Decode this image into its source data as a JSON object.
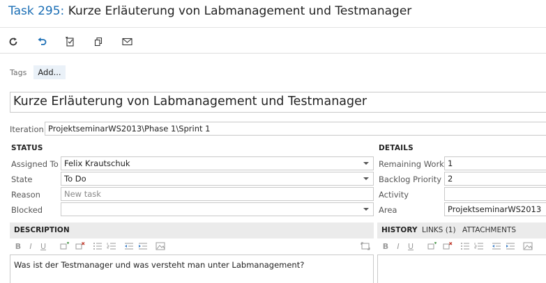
{
  "window": {
    "task_id": "Task 295:",
    "task_title": "Kurze Erläuterung von Labmanagement und Testmanager"
  },
  "toolbar": {
    "items": [
      "refresh-icon",
      "undo-icon",
      "checklist-icon",
      "copy-icon",
      "email-icon"
    ]
  },
  "tags": {
    "label": "Tags",
    "add_label": "Add..."
  },
  "title_field": {
    "value": "Kurze Erläuterung von Labmanagement und Testmanager"
  },
  "iteration": {
    "label": "Iteration",
    "value": "ProjektseminarWS2013\\Phase 1\\Sprint 1"
  },
  "status": {
    "header": "STATUS",
    "assigned_to": {
      "label": "Assigned To",
      "value": "Felix Krautschuk"
    },
    "state": {
      "label": "State",
      "value": "To Do"
    },
    "reason": {
      "label": "Reason",
      "value": "New task"
    },
    "blocked": {
      "label": "Blocked",
      "value": ""
    }
  },
  "details": {
    "header": "DETAILS",
    "remaining_work": {
      "label": "Remaining Work",
      "value": "1"
    },
    "backlog_priority": {
      "label": "Backlog Priority",
      "value": "2"
    },
    "activity": {
      "label": "Activity",
      "value": ""
    },
    "area": {
      "label": "Area",
      "value": "ProjektseminarWS2013"
    }
  },
  "description": {
    "header": "DESCRIPTION",
    "text": "Was ist der Testmanager und was versteht man unter Labmanagement?"
  },
  "tabs": {
    "history": "HISTORY",
    "links": "LINKS (1)",
    "attachments": "ATTACHMENTS"
  },
  "rte": {
    "bold": "B",
    "italic": "I",
    "underline": "U"
  },
  "colors": {
    "accent": "#1a6eb5",
    "header_bg": "#ebebeb",
    "border": "#c9c9c9"
  }
}
